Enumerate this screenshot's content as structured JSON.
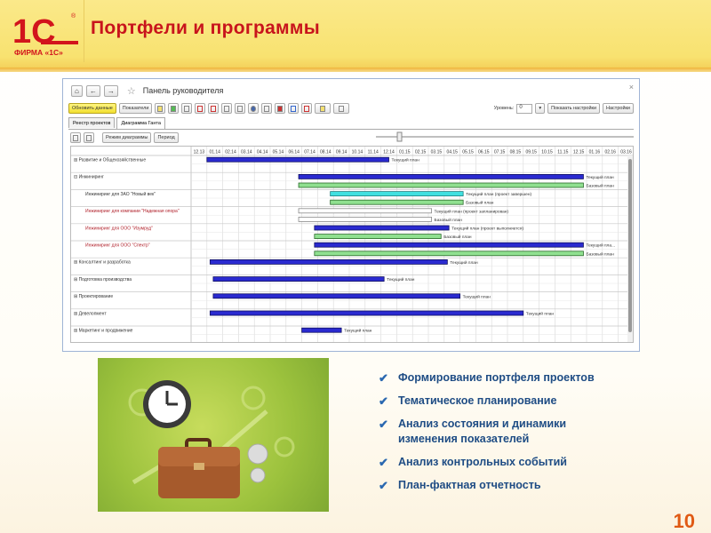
{
  "header": {
    "title": "Портфели и программы",
    "logo_text": "1С",
    "logo_caption": "ФИРМА «1С»"
  },
  "window": {
    "title": "Панель руководителя",
    "home": "⌂",
    "back": "←",
    "forward": "→",
    "star": "☆",
    "close": "×"
  },
  "toolbar": {
    "refresh_label": "Обновить данные",
    "indicators_label": "Показатели",
    "level_label": "Уровень:",
    "level_value": "0",
    "show_settings_label": "Показать настройки",
    "settings_label": "Настройки"
  },
  "tabs": [
    {
      "label": "Реестр проектов"
    },
    {
      "label": "Диаграмма Ганта"
    }
  ],
  "gantt_toolbar": {
    "mode_label": "Режим диаграммы",
    "period_label": "Период"
  },
  "colors": {
    "current": "#2a2ad0",
    "base": "#90e090",
    "done": "#40e0e0",
    "planned": "#ffffff",
    "red_text": "#b0202a"
  },
  "gantt": {
    "months": [
      "12.13",
      "01.14",
      "02.14",
      "03.14",
      "04.14",
      "05.14",
      "06.14",
      "07.14",
      "08.14",
      "09.14",
      "10.14",
      "11.14",
      "12.14",
      "01.15",
      "02.15",
      "03.15",
      "04.15",
      "05.15",
      "06.15",
      "07.15",
      "08.15",
      "09.15",
      "10.15",
      "11.15",
      "12.15",
      "01.16",
      "02.16",
      "03.16"
    ],
    "rows": [
      {
        "label": "⊞ Развитие и Общехозяйственные",
        "level": 0,
        "red": false,
        "bars": [
          {
            "type": "current",
            "start": 1,
            "end": 12.5,
            "label": "Текущий план"
          }
        ]
      },
      {
        "label": "⊟ Инжиниринг",
        "level": 0,
        "red": false,
        "bars": [
          {
            "type": "current",
            "start": 6.8,
            "end": 24.8,
            "label": "Текущий план"
          },
          {
            "type": "base",
            "start": 6.8,
            "end": 24.8,
            "label": "Базовый план"
          }
        ]
      },
      {
        "label": "Инжиниринг для ЗАО \"Новый век\"",
        "level": 1,
        "red": false,
        "bars": [
          {
            "type": "done",
            "start": 8.8,
            "end": 17.2,
            "label": "Текущий план (проект завершен)"
          },
          {
            "type": "base",
            "start": 8.8,
            "end": 17.2,
            "label": "Базовый план"
          }
        ]
      },
      {
        "label": "Инжиниринг для компании \"Надежная опора\"",
        "level": 1,
        "red": true,
        "bars": [
          {
            "type": "planned",
            "start": 6.8,
            "end": 15.2,
            "label": "Текущий план (проект запланирован)"
          },
          {
            "type": "planned",
            "start": 6.8,
            "end": 15.2,
            "label": "Базовый план"
          }
        ]
      },
      {
        "label": "Инжиниринг для ООО \"Изумруд\"",
        "level": 1,
        "red": true,
        "bars": [
          {
            "type": "current",
            "start": 7.8,
            "end": 16.3,
            "label": "Текущий план (проект выполняется)"
          },
          {
            "type": "base",
            "start": 7.8,
            "end": 15.8,
            "label": "Базовый план"
          }
        ]
      },
      {
        "label": "Инжиниринг для ООО \"Спектр\"",
        "level": 1,
        "red": true,
        "bars": [
          {
            "type": "current",
            "start": 7.8,
            "end": 24.8,
            "label": "Текущий пла..."
          },
          {
            "type": "base",
            "start": 7.8,
            "end": 24.8,
            "label": "Базовый план"
          }
        ]
      },
      {
        "label": "⊞ Консалтинг и разработка",
        "level": 0,
        "red": false,
        "bars": [
          {
            "type": "current",
            "start": 1.2,
            "end": 16.2,
            "label": "Текущий план"
          }
        ]
      },
      {
        "label": "⊞ Подготовка производства",
        "level": 0,
        "red": false,
        "bars": [
          {
            "type": "current",
            "start": 1.4,
            "end": 12.2,
            "label": "Текущий план"
          }
        ]
      },
      {
        "label": "⊞ Проектирование",
        "level": 0,
        "red": false,
        "bars": [
          {
            "type": "current",
            "start": 1.4,
            "end": 17,
            "label": "Текущий план"
          }
        ]
      },
      {
        "label": "⊞ Девелопмент",
        "level": 0,
        "red": false,
        "bars": [
          {
            "type": "current",
            "start": 1.2,
            "end": 21,
            "label": "Текущий план"
          }
        ]
      },
      {
        "label": "⊞ Маркетинг и продвижение",
        "level": 0,
        "red": false,
        "bars": [
          {
            "type": "current",
            "start": 7,
            "end": 9.5,
            "label": "Текущий план"
          }
        ]
      }
    ]
  },
  "bullets": [
    "Формирование портфеля проектов",
    "Тематическое планирование",
    "Анализ состояния и динамики изменения показателей",
    "Анализ контрольных событий",
    "План-фактная отчетность"
  ],
  "page_number": "10"
}
